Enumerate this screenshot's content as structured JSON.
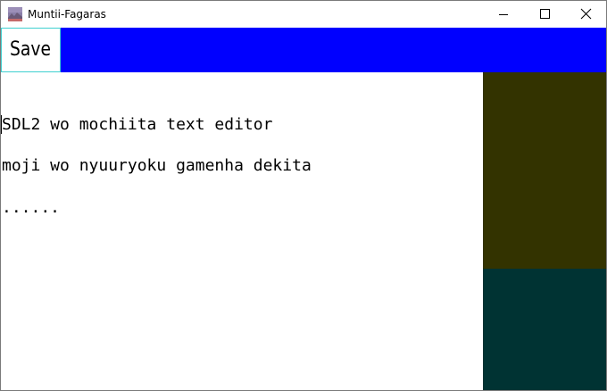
{
  "window": {
    "title": "Muntii-Fagaras",
    "app_icon": "landscape-app-icon",
    "controls": {
      "minimize_icon": "minimize-icon",
      "maximize_icon": "maximize-icon",
      "close_icon": "close-icon"
    }
  },
  "toolbar": {
    "save_label": "Save",
    "background_color": "#0000ff",
    "save_border_color": "#3fd0d0"
  },
  "editor": {
    "lines": [
      "SDL2 wo mochiita text editor",
      "moji wo nyuuryoku gamenha dekita",
      "......"
    ]
  },
  "side_panels": {
    "top_color": "#333300",
    "bottom_color": "#003333"
  }
}
